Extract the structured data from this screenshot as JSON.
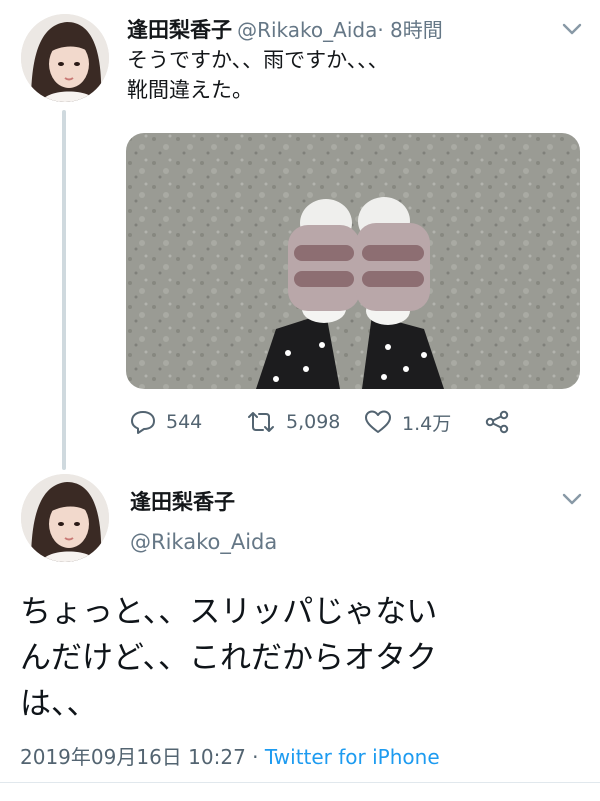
{
  "tweet1": {
    "name": "逢田梨香子",
    "handle": "@Rikako_Aida",
    "time": "· 8時間",
    "text_line1": "そうですか、、雨ですか、、、",
    "text_line2": "靴間違えた。",
    "actions": {
      "replies": "544",
      "retweets": "5,098",
      "likes": "1.4万"
    }
  },
  "tweet2": {
    "name": "逢田梨香子",
    "handle": "@Rikako_Aida",
    "text_line1": "ちょっと、、スリッパじゃない",
    "text_line2": "んだけど、、これだからオタク",
    "text_line3": "は、、",
    "date": "2019年09月16日 10:27",
    "separator": " · ",
    "source": "Twitter for iPhone"
  },
  "icons": [
    "avatar",
    "chevron-down-icon",
    "reply-icon",
    "retweet-icon",
    "like-icon",
    "share-icon"
  ],
  "colors": {
    "link": "#1d9bf0",
    "muted": "#657786",
    "thread_line": "#cfd9de"
  }
}
